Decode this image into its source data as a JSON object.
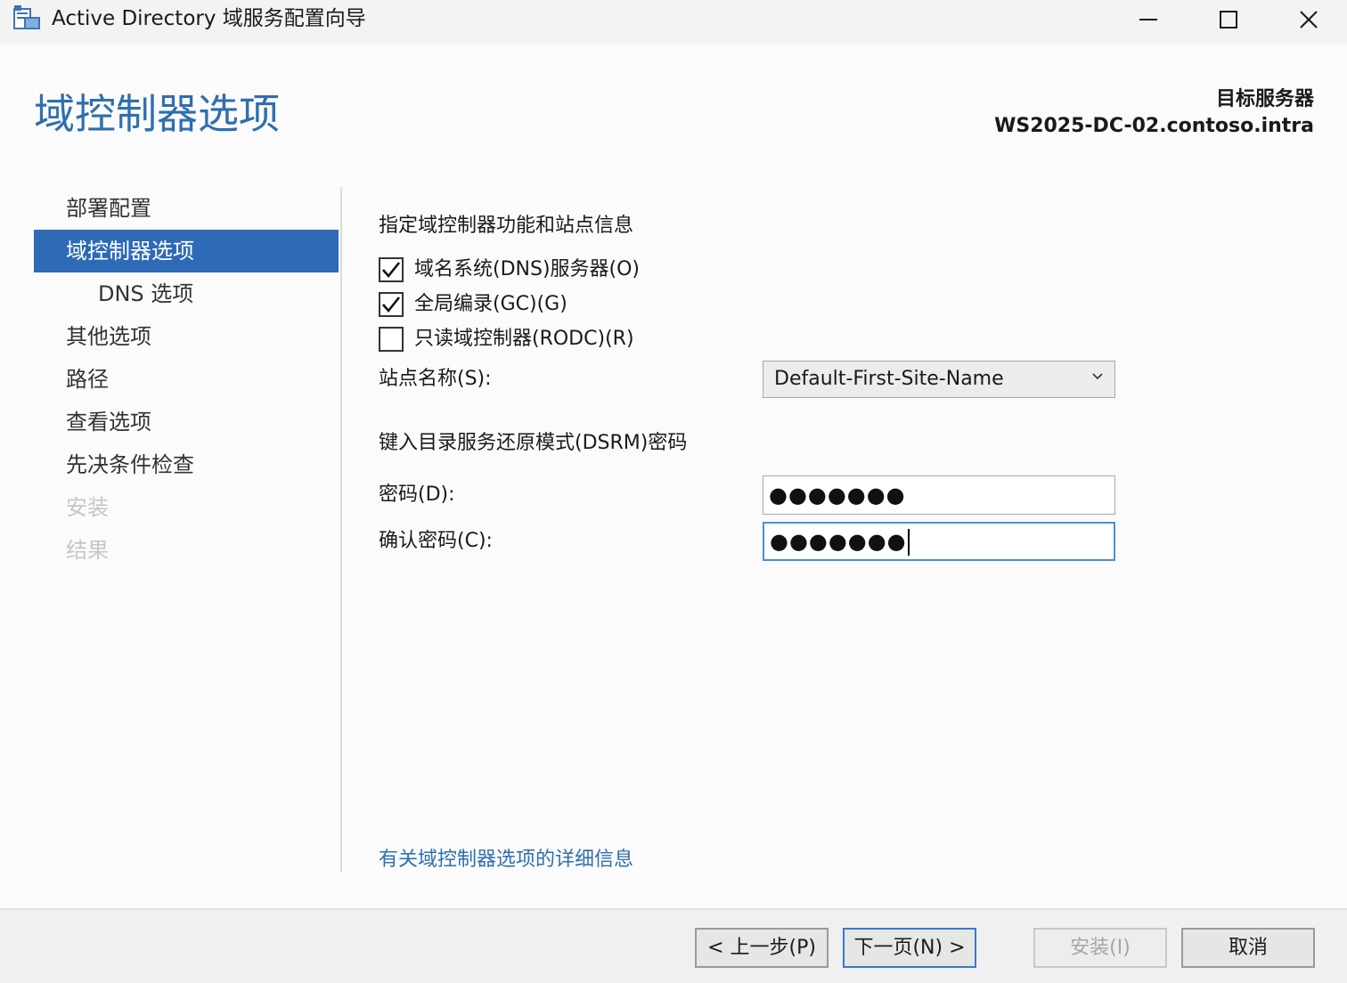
{
  "window": {
    "title": "Active Directory 域服务配置向导",
    "icon": "ad-wizard-icon",
    "controls": [
      "minimize-icon",
      "maximize-icon",
      "close-icon"
    ]
  },
  "header": {
    "page_title": "域控制器选项",
    "target_label": "目标服务器",
    "target_value": "WS2025-DC-02.contoso.intra"
  },
  "sidebar": {
    "items": [
      {
        "label": "部署配置",
        "state": "normal"
      },
      {
        "label": "域控制器选项",
        "state": "selected"
      },
      {
        "label": "DNS 选项",
        "state": "normal"
      },
      {
        "label": "其他选项",
        "state": "normal"
      },
      {
        "label": "路径",
        "state": "normal"
      },
      {
        "label": "查看选项",
        "state": "normal"
      },
      {
        "label": "先决条件检查",
        "state": "normal"
      },
      {
        "label": "安装",
        "state": "disabled"
      },
      {
        "label": "结果",
        "state": "disabled"
      }
    ]
  },
  "main": {
    "section_caption": "指定域控制器功能和站点信息",
    "options": [
      {
        "label": "域名系统(DNS)服务器(O)",
        "checked": true
      },
      {
        "label": "全局编录(GC)(G)",
        "checked": true
      },
      {
        "label": "只读域控制器(RODC)(R)",
        "checked": false
      }
    ],
    "site_label": "站点名称(S):",
    "site_value": "Default-First-Site-Name",
    "dsrm_caption": "键入目录服务还原模式(DSRM)密码",
    "password_label": "密码(D):",
    "password_value": "●●●●●●●",
    "confirm_label": "确认密码(C):",
    "confirm_value": "●●●●●●●",
    "help_link": "有关域控制器选项的详细信息"
  },
  "footer": {
    "prev": "< 上一步(P)",
    "next": "下一页(N) >",
    "install": "安装(I)",
    "cancel": "取消"
  },
  "colors": {
    "accent": "#2e6ab6",
    "title_blue": "#2f6fad",
    "disabled_text": "#c6c6c6"
  }
}
